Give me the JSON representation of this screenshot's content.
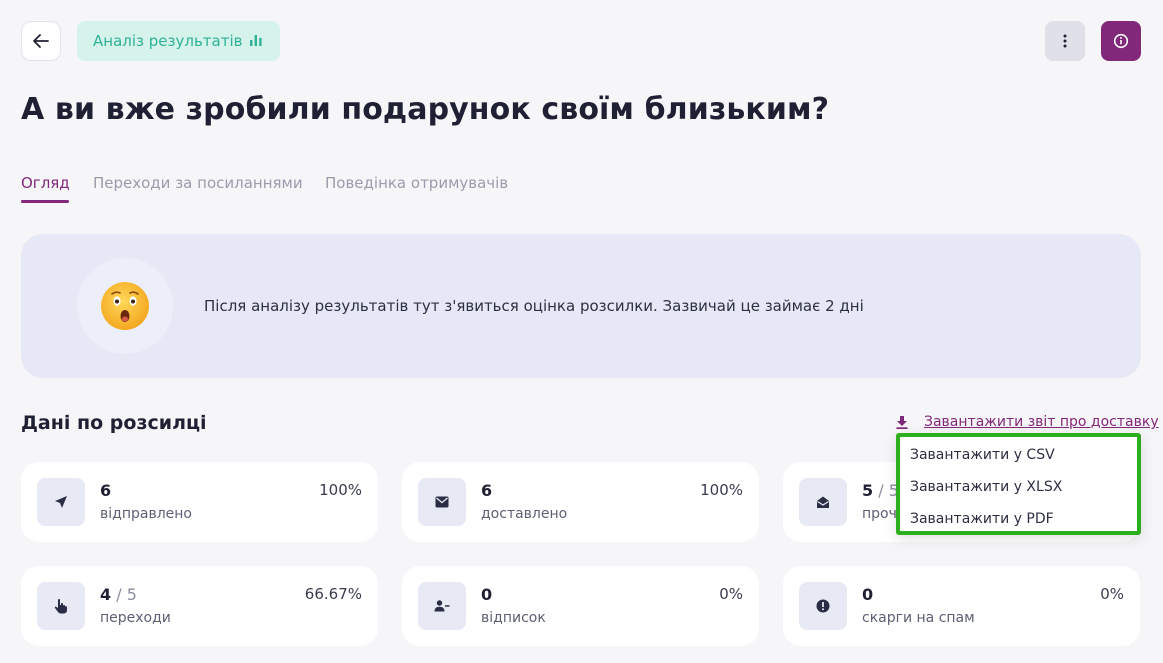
{
  "header": {
    "analysis_label": "Аналіз результатів"
  },
  "page_title": "А ви вже зробили подарунок своїм близьким?",
  "tabs": [
    {
      "label": "Огляд",
      "active": true
    },
    {
      "label": "Переходи за посиланнями",
      "active": false
    },
    {
      "label": "Поведінка отримувачів",
      "active": false
    }
  ],
  "notice": {
    "emoji": "😲",
    "text": "Після аналізу результатів тут з'явиться оцінка розсилки. Зазвичай це займає 2 дні"
  },
  "section": {
    "title": "Дані по розсилці",
    "download_label": "Завантажити звіт про доставку"
  },
  "cards": [
    {
      "icon": "send-icon",
      "value": "6",
      "of": "",
      "label": "відправлено",
      "percent": "100%"
    },
    {
      "icon": "envelope-icon",
      "value": "6",
      "of": "",
      "label": "доставлено",
      "percent": "100%"
    },
    {
      "icon": "open-envelope-icon",
      "value": "5",
      "of": " / 5",
      "label": "прочитано",
      "percent": ""
    },
    {
      "icon": "pointer-hand-icon",
      "value": "4",
      "of": " / 5",
      "label": "переходи",
      "percent": "66.67%"
    },
    {
      "icon": "user-remove-icon",
      "value": "0",
      "of": "",
      "label": "відписок",
      "percent": "0%"
    },
    {
      "icon": "alert-icon",
      "value": "0",
      "of": "",
      "label": "скарги на спам",
      "percent": "0%"
    }
  ],
  "dropdown": {
    "items": [
      "Завантажити у CSV",
      "Завантажити у XLSX",
      "Завантажити у PDF"
    ]
  },
  "colors": {
    "accent": "#82287a",
    "teal": "#2fb197",
    "highlight": "#2dae1f"
  }
}
